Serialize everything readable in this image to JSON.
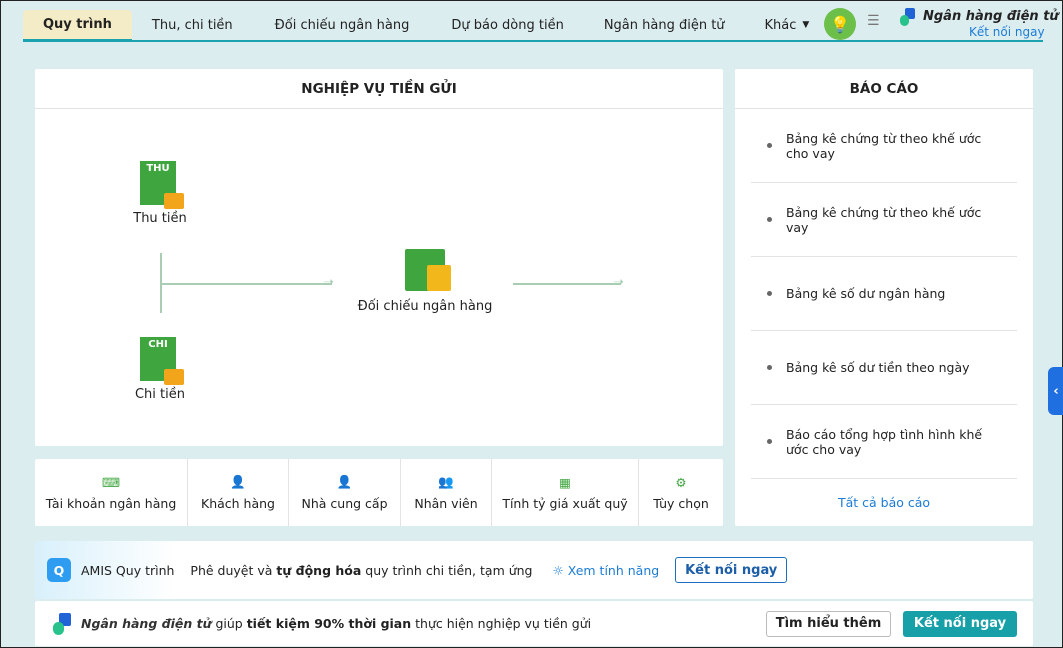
{
  "tabs": [
    "Quy trình",
    "Thu, chi tiền",
    "Đối chiếu ngân hàng",
    "Dự báo dòng tiền",
    "Ngân hàng điện tử",
    "Khác"
  ],
  "header": {
    "bank_title": "Ngân hàng điện tử",
    "connect": "Kết nối ngay"
  },
  "process": {
    "title": "NGHIỆP VỤ TIỀN GỬI",
    "thu": "Thu tiền",
    "thu_tag": "THU",
    "chi": "Chi tiền",
    "chi_tag": "CHI",
    "doichieu": "Đối chiếu ngân hàng"
  },
  "shortcuts": [
    "Tài khoản ngân hàng",
    "Khách hàng",
    "Nhà cung cấp",
    "Nhân viên",
    "Tính tỷ giá xuất quỹ",
    "Tùy chọn"
  ],
  "reports": {
    "title": "BÁO CÁO",
    "items": [
      "Bảng kê chứng từ theo khế ước cho vay",
      "Bảng kê chứng từ theo khế ước vay",
      "Bảng kê số dư ngân hàng",
      "Bảng kê số dư tiền theo ngày",
      "Báo cáo tổng hợp tình hình khế ước cho vay"
    ],
    "all": "Tất cả báo cáo"
  },
  "amis": {
    "name": "AMIS Quy trình",
    "text1": "Phê duyệt và ",
    "bold": "tự động hóa",
    "text2": " quy trình chi tiền, tạm ứng",
    "feature": "Xem tính năng",
    "connect": "Kết nối ngay"
  },
  "bank": {
    "name": "Ngân hàng điện tử",
    "text1": " giúp ",
    "bold": "tiết kiệm 90% thời gian",
    "text2": " thực hiện nghiệp vụ tiền gửi",
    "learn": "Tìm hiểu thêm",
    "connect": "Kết nối ngay"
  }
}
